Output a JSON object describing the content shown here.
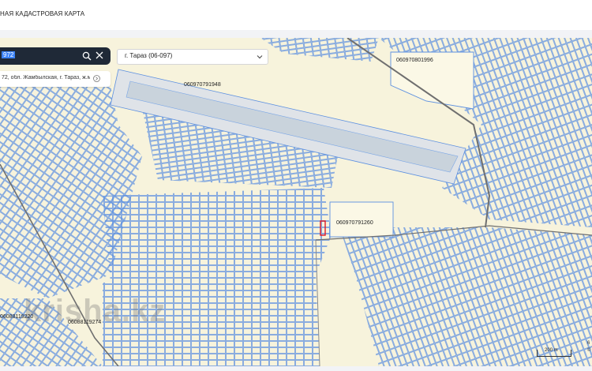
{
  "header": {
    "title": "НАЯ КАДАСТРОВАЯ КАРТА"
  },
  "search": {
    "value": "972"
  },
  "region": {
    "selected": "г. Тараз (06-097)"
  },
  "result": {
    "text": "72, обл. Жамбылская, г. Тараз, ж.м. С..."
  },
  "map": {
    "parcel_labels": [
      "060970801996",
      "060970791948",
      "060970791260",
      "06088119220",
      "06088119274"
    ],
    "scale": "200 m",
    "side_labels": [
      "6",
      "©"
    ],
    "watermark": "krisha.kz"
  }
}
